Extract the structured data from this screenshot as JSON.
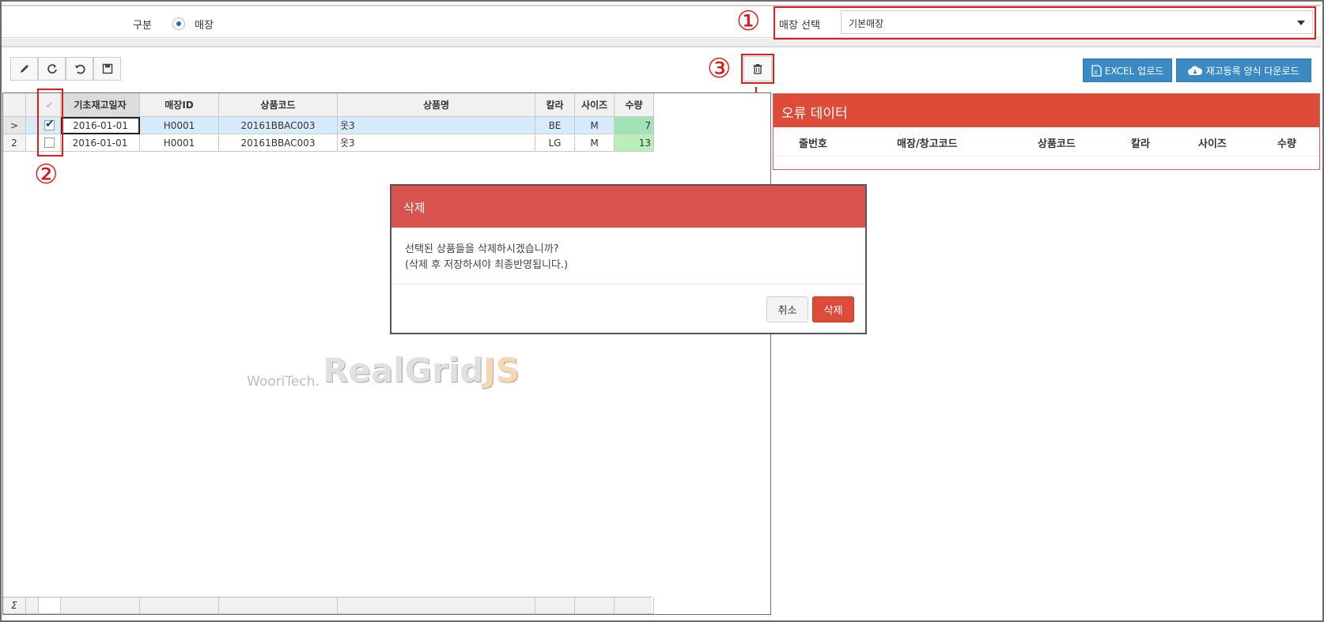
{
  "filter": {
    "group_label": "구분",
    "radio_label": "매장",
    "store_select_label": "매장 선택",
    "store_select_value": "기본매장"
  },
  "markers": {
    "one": "①",
    "two": "②",
    "three": "③"
  },
  "toolbar": {
    "icons": [
      "pencil-icon",
      "refresh-icon",
      "undo-icon",
      "save-icon"
    ],
    "delete_icon": "trash-icon",
    "excel_upload_label": "EXCEL 업로드",
    "template_download_label": "재고등록 양식 다운로드"
  },
  "grid": {
    "columns": [
      "기초재고일자",
      "매장ID",
      "상품코드",
      "상품명",
      "칼라",
      "사이즈",
      "수량"
    ],
    "rows": [
      {
        "indicator": ">",
        "checked": true,
        "date": "2016-01-01",
        "store_id": "H0001",
        "product_code": "20161BBAC003",
        "product_name": "옷3",
        "color": "BE",
        "size": "M",
        "qty": "7"
      },
      {
        "indicator": "2",
        "checked": false,
        "date": "2016-01-01",
        "store_id": "H0001",
        "product_code": "20161BBAC003",
        "product_name": "옷3",
        "color": "LG",
        "size": "M",
        "qty": "13"
      }
    ],
    "footer_symbol": "Σ"
  },
  "error_panel": {
    "title": "오류 데이터",
    "columns": [
      "줄번호",
      "매장/창고코드",
      "상품코드",
      "칼라",
      "사이즈",
      "수량"
    ]
  },
  "modal": {
    "title": "삭제",
    "line1": "선택된 상품들을 삭제하시겠습니까?",
    "line2": "(삭제 후 저장하셔야 최종반영됩니다.)",
    "cancel_label": "취소",
    "confirm_label": "삭제"
  },
  "watermark": {
    "company": "WooriTech.",
    "product_a": "RealGrid",
    "product_b": "JS"
  },
  "colors": {
    "accent_blue": "#3a8ac6",
    "danger_red": "#d9534f",
    "annotation_red": "#e21b1b",
    "qty_green": "#b9f0b9",
    "selected_row": "#d8ebfb"
  }
}
